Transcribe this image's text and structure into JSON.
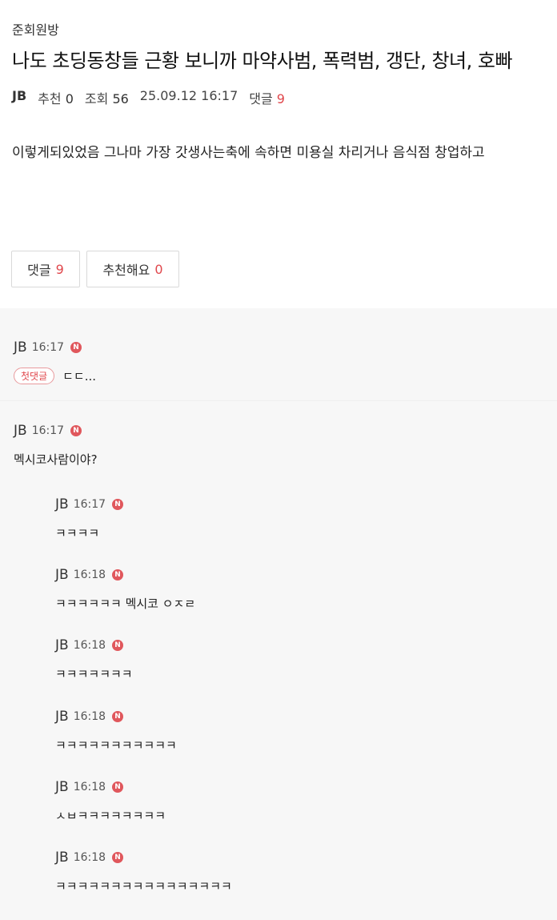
{
  "board_name": "준회원방",
  "title": "나도 초딩동창들 근황 보니까 마약사범, 폭력범, 갱단, 창녀, 호빠",
  "meta": {
    "author": "JB",
    "recommend_label": "추천",
    "recommend_count": "0",
    "views_label": "조회",
    "views_count": "56",
    "datetime": "25.09.12 16:17",
    "comments_label": "댓글",
    "comments_count": "9"
  },
  "body": "이렇게되있었음 그나마 가장 갓생사는축에 속하면 미용실 차리거나 음식점 창업하고",
  "buttons": {
    "comments_label": "댓글",
    "comments_count": "9",
    "recommend_label": "추천해요",
    "recommend_count": "0"
  },
  "new_badge": "N",
  "first_comment_badge": "첫댓글",
  "comments": [
    {
      "author": "JB",
      "time": "16:17",
      "text": "ㄷㄷ..."
    },
    {
      "author": "JB",
      "time": "16:17",
      "text": "멕시코사람이야?"
    },
    {
      "author": "JB",
      "time": "16:17",
      "text": "ㅋㅋㅋㅋ"
    },
    {
      "author": "JB",
      "time": "16:18",
      "text": "ㅋㅋㅋㅋㅋㅋ 멕시코 ㅇㅈㄹ"
    },
    {
      "author": "JB",
      "time": "16:18",
      "text": "ㅋㅋㅋㅋㅋㅋㅋ"
    },
    {
      "author": "JB",
      "time": "16:18",
      "text": "ㅋㅋㅋㅋㅋㅋㅋㅋㅋㅋㅋ"
    },
    {
      "author": "JB",
      "time": "16:18",
      "text": "ㅅㅂㅋㅋㅋㅋㅋㅋㅋㅋ"
    },
    {
      "author": "JB",
      "time": "16:18",
      "text": "ㅋㅋㅋㅋㅋㅋㅋㅋㅋㅋㅋㅋㅋㅋㅋㅋ"
    }
  ],
  "colors": {
    "accent_red": "#e0474c",
    "comments_bg": "#f7f7f7"
  }
}
